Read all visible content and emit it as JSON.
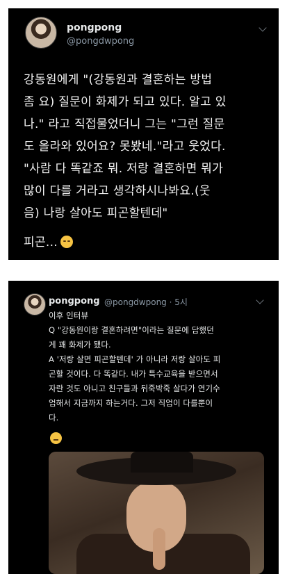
{
  "tweet1": {
    "name": "pongpong",
    "handle": "@pongdwpong",
    "lines": [
      "강동원에게 \"(강동원과 결혼하는 방법",
      "좀 요) 질문이 화제가 되고 있다. 알고 있",
      "나.\" 라고 직접물었더니 그는 \"그런 질문",
      "도 올라와 있어요? 못봤네.\"라고 웃었다.",
      "\"사람 다 똑같죠 뭐. 저랑 결혼하면 뭐가",
      "많이 다를 거라고 생각하시나봐요.(웃",
      "음) 나랑 살아도 피곤할텐데\"",
      "피곤..."
    ],
    "emoji": "disappointed-face-icon"
  },
  "tweet2": {
    "name": "pongpong",
    "handle_time": "@pongdwpong · 5시",
    "lines": [
      "이후 인터뷰",
      "Q \"강동원이랑 결혼하려면\"이라는 질문에 답했던",
      "게 꽤 화제가 됐다.",
      "A '저랑 살면 피곤할텐데' 가 아니라 저랑 살아도 피",
      "곤할 것이다. 다 똑같다. 내가 특수교육을 받으면서",
      "자란 것도 아니고 친구들과 뒤죽박죽 살다가 연기수",
      "업해서 지금까지 하는거다. 그저 직업이 다를뿐이",
      "다."
    ],
    "emoji": "thinking-face-icon",
    "image": "photo"
  },
  "colors": {
    "card_bg": "#000000",
    "text": "#e7e9ea",
    "muted": "#8b98a5"
  }
}
